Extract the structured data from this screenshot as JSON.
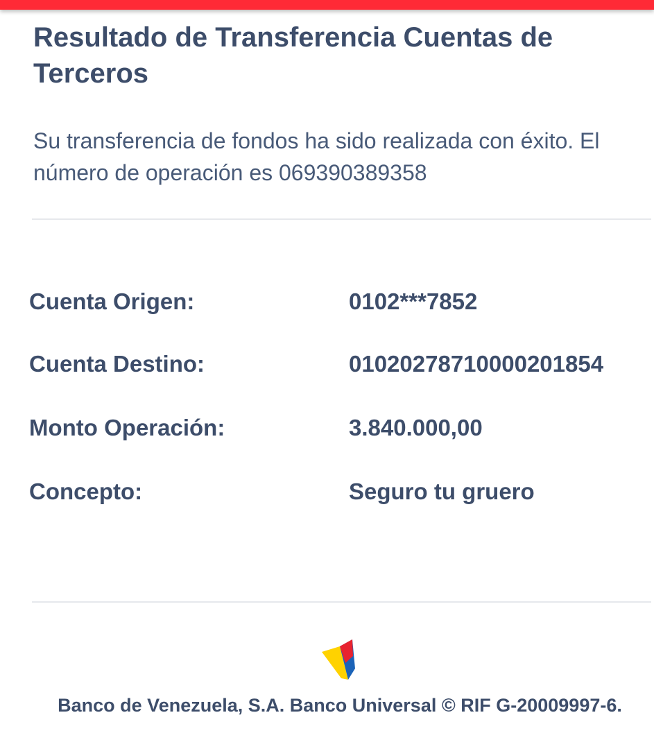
{
  "header": {
    "title": "Resultado de Transferencia Cuentas de Terceros"
  },
  "result": {
    "message": "Su transferencia de fondos ha sido realizada con éxito. El número de operación es 069390389358"
  },
  "details": [
    {
      "label": "Cuenta Origen:",
      "value": "0102***7852"
    },
    {
      "label": "Cuenta Destino:",
      "value": "01020278710000201854"
    },
    {
      "label": "Monto Operación:",
      "value": "3.840.000,00"
    },
    {
      "label": "Concepto:",
      "value": "Seguro tu gruero"
    }
  ],
  "footer": {
    "text": "Banco de Venezuela, S.A. Banco Universal © RIF G-20009997-6."
  },
  "colors": {
    "top_bar": "#ff2a36",
    "text": "#3d4d6a",
    "logo_yellow": "#ffd200",
    "logo_blue": "#1b63b8",
    "logo_red": "#e8232f"
  },
  "icons": {
    "logo": "bank-logo-icon"
  }
}
